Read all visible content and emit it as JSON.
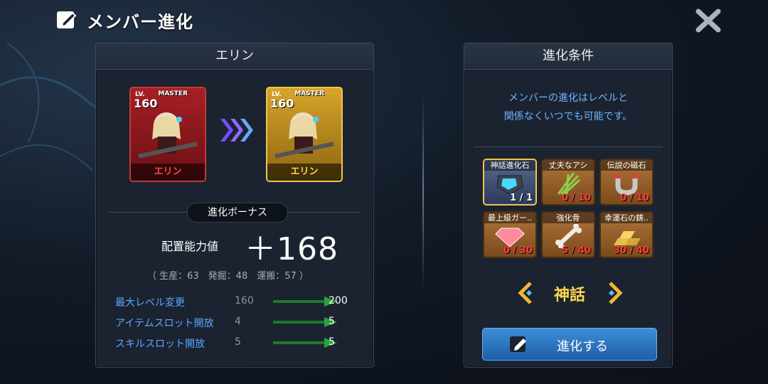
{
  "header": {
    "title": "メンバー進化",
    "title_icon": "edit-icon",
    "close_icon": "close-icon"
  },
  "left_panel": {
    "title": "エリン",
    "before_card": {
      "lv_label": "LV.",
      "level": "160",
      "rank": "MASTER",
      "name": "エリン",
      "frame_color": "#c23a3a"
    },
    "after_card": {
      "lv_label": "LV.",
      "level": "160",
      "rank": "MASTER",
      "name": "エリン",
      "frame_color": "#f0c64c"
    },
    "bonus_label": "進化ボーナス",
    "stat_label": "配置能力値",
    "stat_value": "＋168",
    "stat_breakdown": "（ 生産：63　発掘：48　運搬：57 ）",
    "changes": [
      {
        "label": "最大レベル変更",
        "from": "160",
        "to": "200"
      },
      {
        "label": "アイテムスロット開放",
        "from": "4",
        "to": "5"
      },
      {
        "label": "スキルスロット開放",
        "from": "5",
        "to": "5"
      }
    ]
  },
  "right_panel": {
    "title": "進化条件",
    "description_line1": "メンバーの進化はレベルと",
    "description_line2": "関係なくいつでも可能です。",
    "materials": [
      {
        "name": "神話進化石",
        "count": "1 / 1",
        "icon": "evolution-stone-icon"
      },
      {
        "name": "丈夫なアシ",
        "count": "0 / 10",
        "icon": "reed-icon"
      },
      {
        "name": "伝説の磁石",
        "count": "0 / 10",
        "icon": "magnet-icon"
      },
      {
        "name": "最上級ガー..",
        "count": "0 / 30",
        "icon": "garnet-icon"
      },
      {
        "name": "強化骨",
        "count": "5 / 40",
        "icon": "bone-icon"
      },
      {
        "name": "幸運石の鋳..",
        "count": "30 / 40",
        "icon": "gold-ingot-icon"
      }
    ],
    "tier": "神話",
    "evolve_button": "進化する"
  },
  "colors": {
    "accent_blue": "#5aa8ff",
    "gold": "#ffd84a",
    "red": "#ff3a3a",
    "button": "#2e78c2"
  }
}
